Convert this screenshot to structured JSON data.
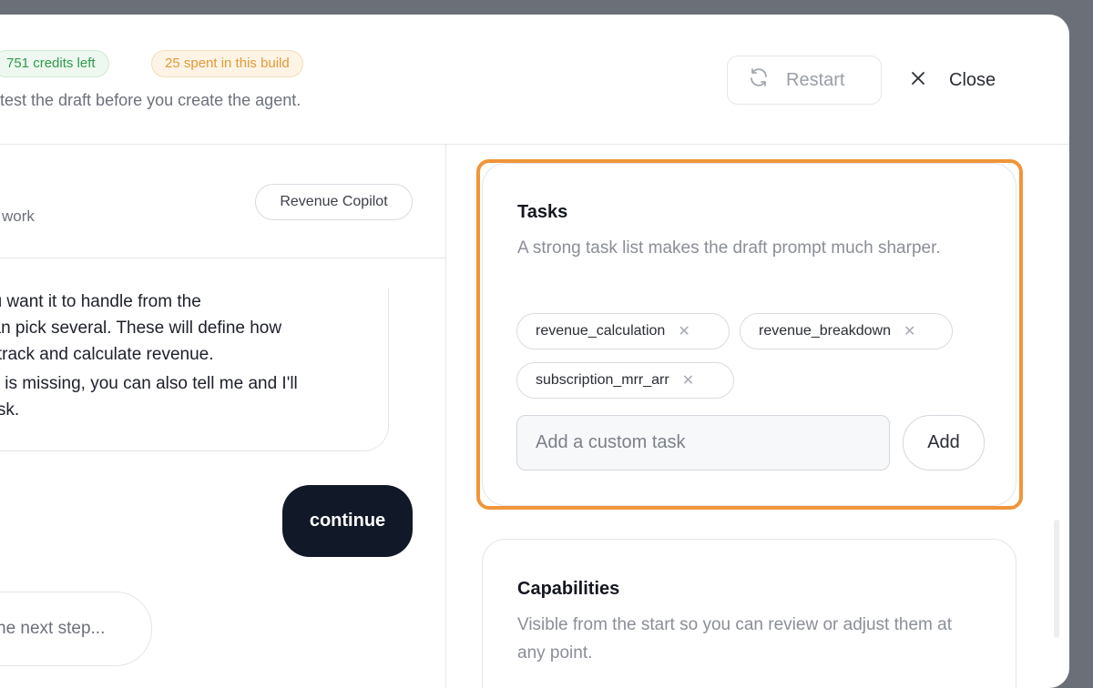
{
  "header": {
    "credits_left": "751 credits left",
    "spent": "25 spent in this build",
    "subtitle": "test the draft before you create the agent.",
    "restart_label": "Restart",
    "close_label": "Close"
  },
  "chat": {
    "work_text": "work",
    "agent_pill": "Revenue Copilot",
    "message_lines": [
      "ou want it to handle from the",
      "can pick several. These will define how",
      "u track and calculate revenue.",
      "fic is missing, you can also tell me and I'll",
      " task."
    ],
    "continue_label": "continue",
    "input_placeholder": "he next step..."
  },
  "tasks": {
    "title": "Tasks",
    "description": "A strong task list makes the draft prompt much sharper.",
    "chips": [
      "revenue_calculation",
      "revenue_breakdown",
      "subscription_mrr_arr"
    ],
    "custom_placeholder": "Add a custom task",
    "add_label": "Add"
  },
  "capabilities": {
    "title": "Capabilities",
    "description": "Visible from the start so you can review or adjust them at any point."
  },
  "colors": {
    "highlight": "#f0953a",
    "primary_dark": "#111827",
    "credits_green": "#2e9a4c",
    "spent_orange": "#e29a34"
  }
}
